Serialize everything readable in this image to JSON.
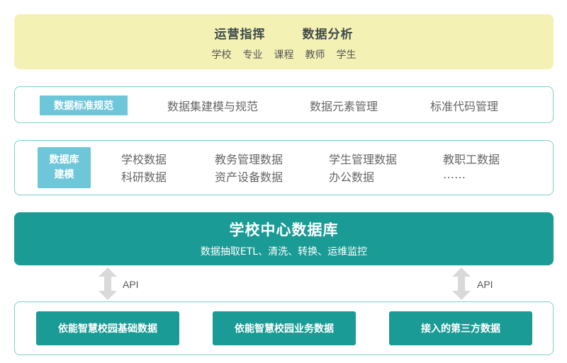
{
  "top_band": {
    "titles": [
      "运营指挥",
      "数据分析"
    ],
    "items": [
      "学校",
      "专业",
      "课程",
      "教师",
      "学生"
    ],
    "color": "#f3f1b4"
  },
  "standards": {
    "tag": "数据标准规范",
    "items": [
      "数据集建模与规范",
      "数据元素管理",
      "标准代码管理"
    ]
  },
  "modeling": {
    "tag_line1": "数据库",
    "tag_line2": "建模",
    "items": [
      [
        "学校数据",
        "教务管理数据",
        "学生管理数据",
        "教职工数据"
      ],
      [
        "科研数据",
        "资产设备数据",
        "办公数据",
        "……"
      ]
    ]
  },
  "central": {
    "title": "学校中心数据库",
    "subtitle": "数据抽取ETL、清洗、转换、运维监控",
    "color": "#1a9b95"
  },
  "api": {
    "left_label": "API",
    "right_label": "API"
  },
  "sources": {
    "items": [
      "依能智慧校园基础数据",
      "依能智慧校园业务数据",
      "接入的第三方数据"
    ]
  },
  "colors": {
    "accent": "#1a9b95",
    "tag": "#6ec6d9",
    "border": "#7fcfc9",
    "arrow": "#d9d9d9"
  }
}
